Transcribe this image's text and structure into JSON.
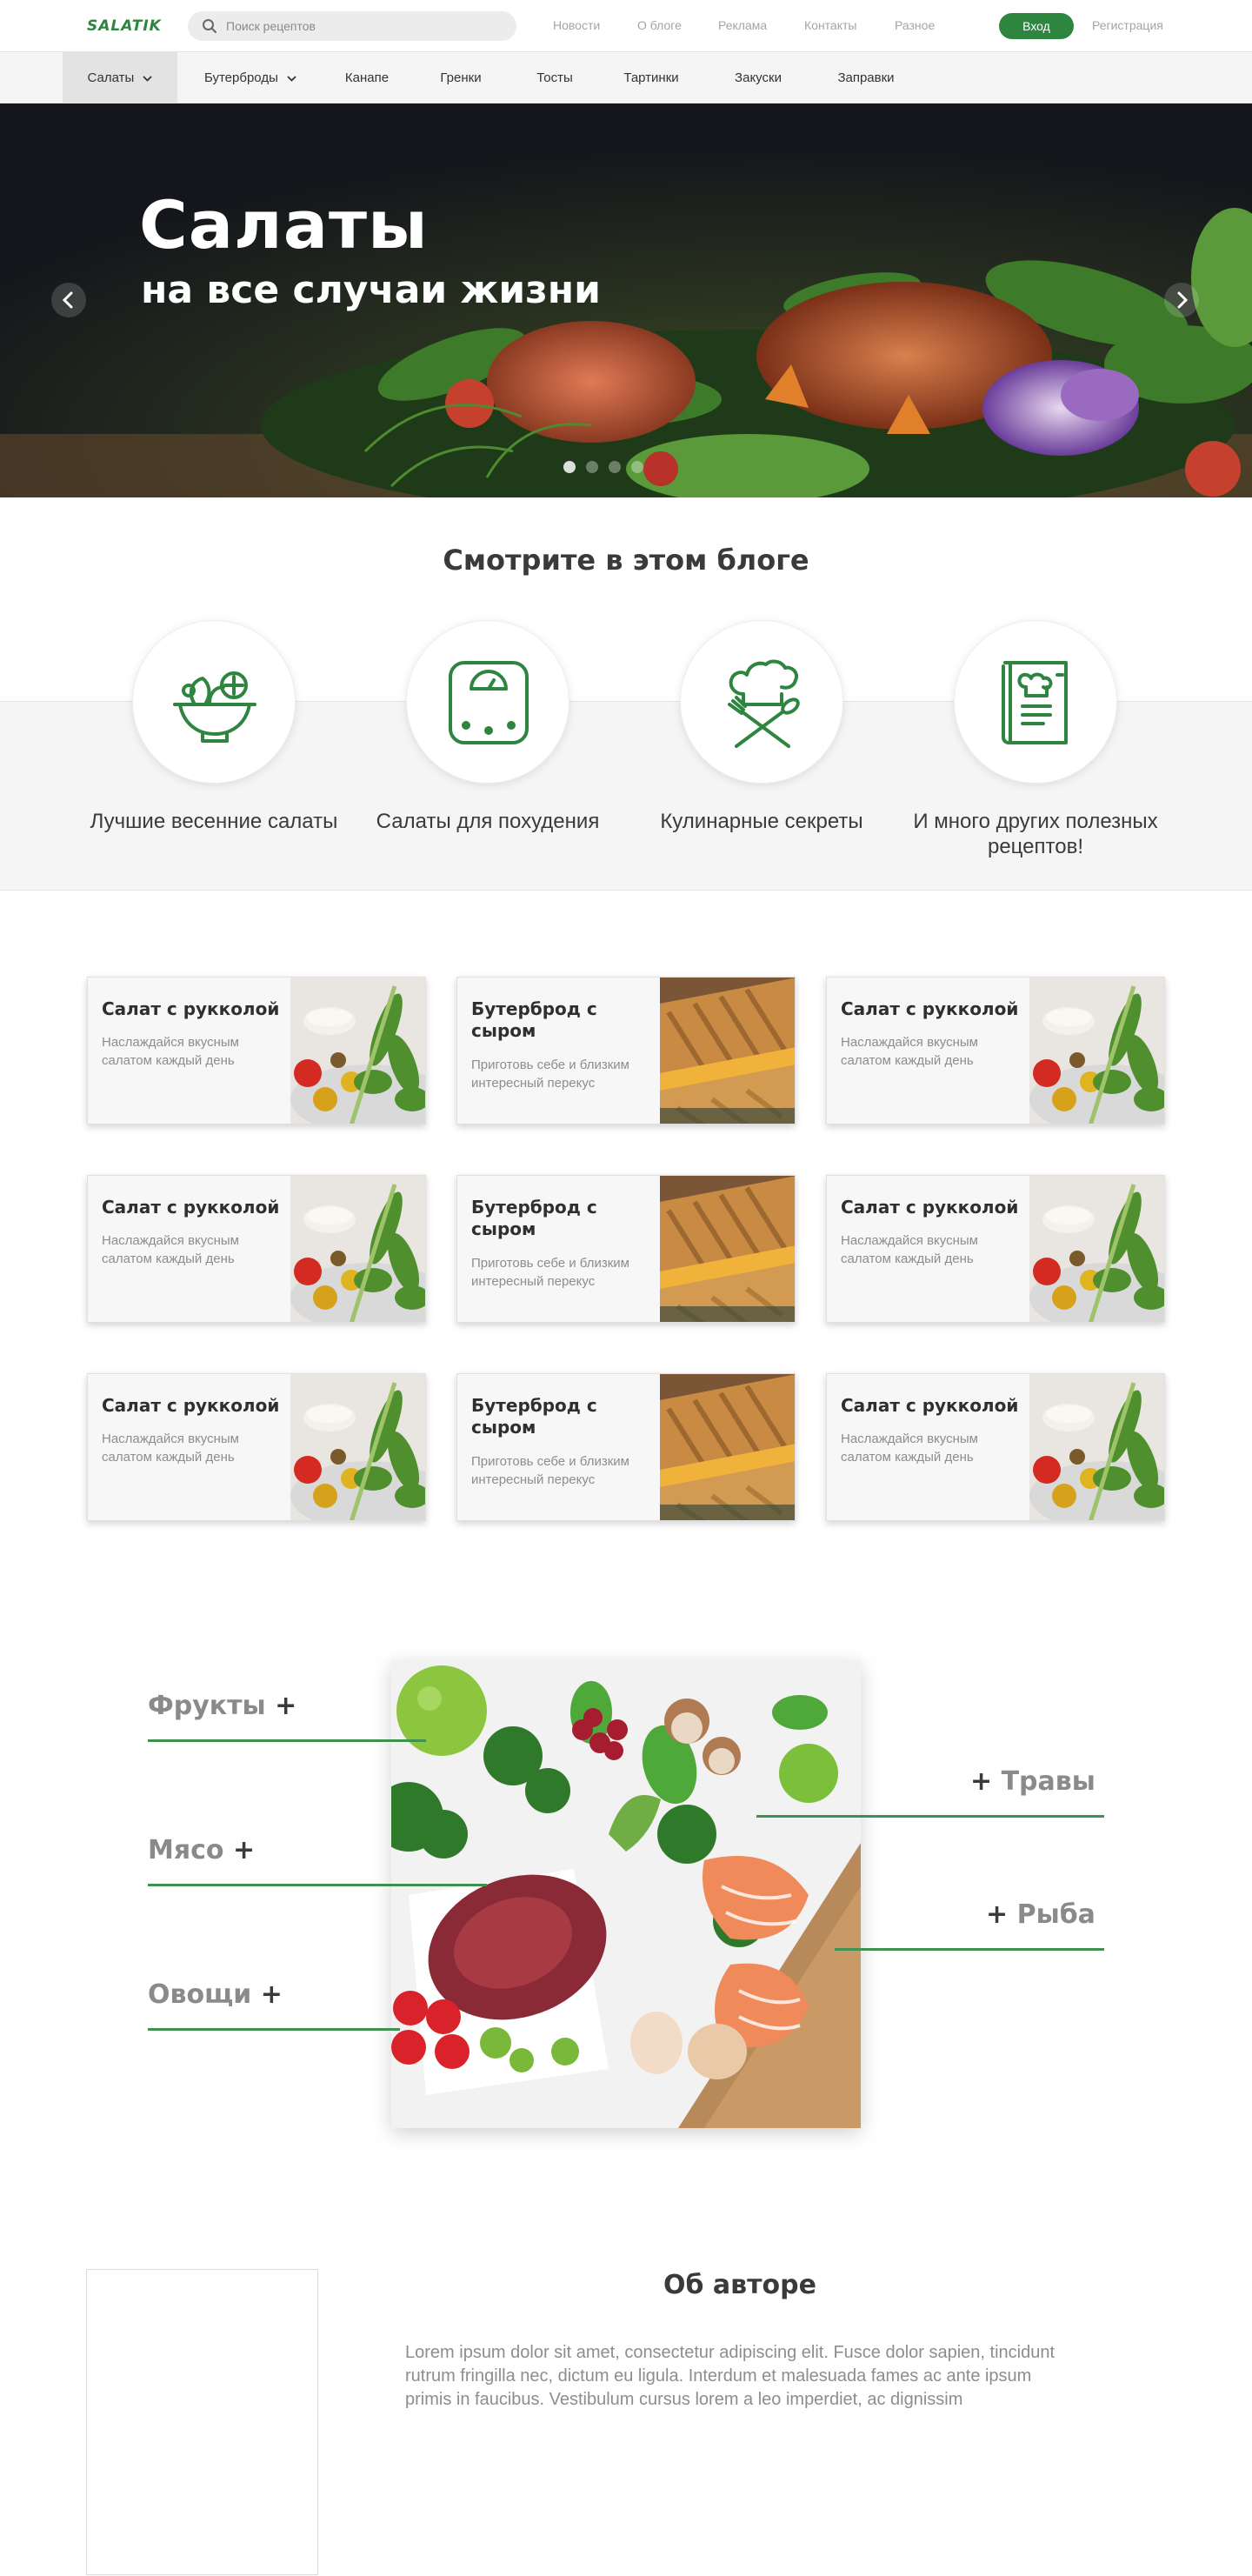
{
  "colors": {
    "accent": "#2e8540",
    "line": "#3e9150"
  },
  "header": {
    "logo": "SALATIK",
    "search_placeholder": "Поиск рецептов",
    "nav": [
      "Новости",
      "О блоге",
      "Реклама",
      "Контакты",
      "Разное"
    ],
    "login_label": "Вход",
    "register_label": "Регистрация"
  },
  "categories": [
    {
      "label": "Салаты",
      "dropdown": true,
      "active": true
    },
    {
      "label": "Бутерброды",
      "dropdown": true,
      "active": false
    },
    {
      "label": "Канапе"
    },
    {
      "label": "Гренки"
    },
    {
      "label": "Тосты"
    },
    {
      "label": "Тартинки"
    },
    {
      "label": "Закуски"
    },
    {
      "label": "Заправки"
    }
  ],
  "hero": {
    "title": "Салаты",
    "subtitle": "на все случаи жизни",
    "slide_count": 4,
    "active_slide": 0,
    "prev_icon": "chevron-left-icon",
    "next_icon": "chevron-right-icon"
  },
  "features": {
    "title": "Смотрите в этом блоге",
    "items": [
      {
        "label": "Лучшие весенние салаты",
        "icon": "salad-bowl-icon"
      },
      {
        "label": "Салаты для похудения",
        "icon": "scale-icon"
      },
      {
        "label": "Кулинарные секреты",
        "icon": "chef-hat-icon"
      },
      {
        "label": "И много других полезных рецептов!",
        "icon": "recipe-book-icon"
      }
    ]
  },
  "cards": [
    {
      "title": "Салат с рукколой",
      "desc": "Наслаждайся вкусным салатом каждый день",
      "image": "salad"
    },
    {
      "title": "Бутерброд с сыром",
      "desc": "Приготовь себе и близким интересный перекус",
      "image": "sandwich"
    },
    {
      "title": "Салат с рукколой",
      "desc": "Наслаждайся вкусным салатом каждый день",
      "image": "salad"
    },
    {
      "title": "Салат с рукколой",
      "desc": "Наслаждайся вкусным салатом каждый день",
      "image": "salad"
    },
    {
      "title": "Бутерброд с сыром",
      "desc": "Приготовь себе и близким интересный перекус",
      "image": "sandwich"
    },
    {
      "title": "Салат с рукколой",
      "desc": "Наслаждайся вкусным салатом каждый день",
      "image": "salad"
    },
    {
      "title": "Салат с рукколой",
      "desc": "Наслаждайся вкусным салатом каждый день",
      "image": "salad"
    },
    {
      "title": "Бутерброд с сыром",
      "desc": "Приготовь себе и близким интересный перекус",
      "image": "sandwich"
    },
    {
      "title": "Салат с рукколой",
      "desc": "Наслаждайся вкусным салатом каждый день",
      "image": "salad"
    }
  ],
  "ingredients": {
    "left": [
      "Фрукты",
      "Мясо",
      "Овощи"
    ],
    "right": [
      "Травы",
      "Рыба"
    ],
    "plus": "+"
  },
  "about": {
    "title": "Об авторе",
    "text": "Lorem ipsum dolor sit amet, consectetur adipiscing elit. Fusce dolor sapien, tincidunt rutrum fringilla nec, dictum eu ligula. Interdum et malesuada fames ac ante ipsum primis in faucibus. Vestibulum cursus lorem a leo imperdiet, ac dignissim"
  }
}
